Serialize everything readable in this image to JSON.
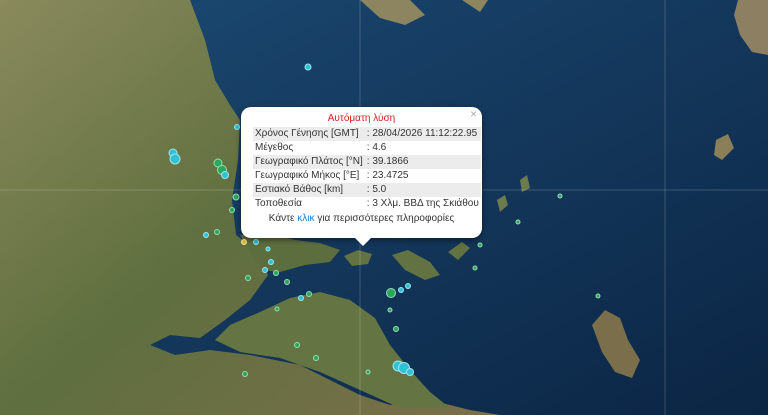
{
  "popup": {
    "title": "Αυτόματη λύση",
    "close": "×",
    "rows": [
      {
        "label": "Χρόνος Γένησης [GMT]",
        "value": ": 28/04/2026 11:12:22.95"
      },
      {
        "label": "Μέγεθος",
        "value": ": 4.6"
      },
      {
        "label": "Γεωγραφικό Πλάτος [°N]",
        "value": ": 39.1866"
      },
      {
        "label": "Γεωγραφικό Μήκος [°E]",
        "value": ": 23.4725"
      },
      {
        "label": "Εστιακό Βάθος [km]",
        "value": ": 5.0"
      },
      {
        "label": "Τοποθεσία",
        "value": ": 3 Χλμ. ΒΒΔ της Σκιάθου"
      }
    ],
    "more_prefix": "Κάντε",
    "more_link": "κλικ",
    "more_suffix": "για περισσότερες πληροφορίες"
  },
  "colors": {
    "sea": "#0f2f52",
    "land": "#6b7a4a",
    "cyan": "#2fc2d6",
    "green": "#27a85a",
    "yellow": "#e0c23a"
  }
}
